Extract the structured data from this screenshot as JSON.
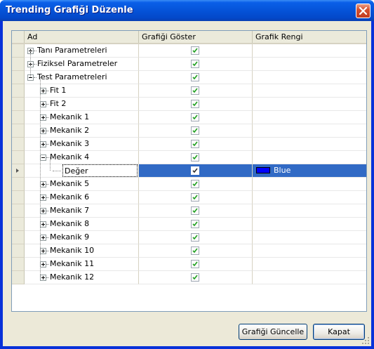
{
  "window": {
    "title": "Trending Grafiği Düzenle"
  },
  "grid": {
    "columns": [
      "Ad",
      "Grafiği Göster",
      "Grafik Rengi"
    ],
    "rows": [
      {
        "label": "Tanı Parametreleri",
        "level": 0,
        "state": "collapsed",
        "checked": true,
        "color": ""
      },
      {
        "label": "Fiziksel Parametreler",
        "level": 0,
        "state": "collapsed",
        "checked": true,
        "color": ""
      },
      {
        "label": "Test Parametreleri",
        "level": 0,
        "state": "expanded",
        "checked": true,
        "color": ""
      },
      {
        "label": "Fit 1",
        "level": 1,
        "state": "collapsed",
        "checked": true,
        "color": ""
      },
      {
        "label": "Fit 2",
        "level": 1,
        "state": "collapsed",
        "checked": true,
        "color": ""
      },
      {
        "label": "Mekanik 1",
        "level": 1,
        "state": "collapsed",
        "checked": true,
        "color": ""
      },
      {
        "label": "Mekanik 2",
        "level": 1,
        "state": "collapsed",
        "checked": true,
        "color": ""
      },
      {
        "label": "Mekanik 3",
        "level": 1,
        "state": "collapsed",
        "checked": true,
        "color": ""
      },
      {
        "label": "Mekanik 4",
        "level": 1,
        "state": "expanded",
        "checked": true,
        "color": ""
      },
      {
        "label": "Değer",
        "level": 2,
        "state": "leaf",
        "checked": true,
        "color": "Blue",
        "color_hex": "#0000ff",
        "selected": true
      },
      {
        "label": "Mekanik 5",
        "level": 1,
        "state": "collapsed",
        "checked": true,
        "color": ""
      },
      {
        "label": "Mekanik 6",
        "level": 1,
        "state": "collapsed",
        "checked": true,
        "color": ""
      },
      {
        "label": "Mekanik 7",
        "level": 1,
        "state": "collapsed",
        "checked": true,
        "color": ""
      },
      {
        "label": "Mekanik 8",
        "level": 1,
        "state": "collapsed",
        "checked": true,
        "color": ""
      },
      {
        "label": "Mekanik 9",
        "level": 1,
        "state": "collapsed",
        "checked": true,
        "color": ""
      },
      {
        "label": "Mekanik 10",
        "level": 1,
        "state": "collapsed",
        "checked": true,
        "color": ""
      },
      {
        "label": "Mekanik 11",
        "level": 1,
        "state": "collapsed",
        "checked": true,
        "color": ""
      },
      {
        "label": "Mekanik 12",
        "level": 1,
        "state": "collapsed",
        "checked": true,
        "color": ""
      }
    ]
  },
  "buttons": {
    "update": "Grafiği Güncelle",
    "close": "Kapat"
  },
  "colors": {
    "selection": "#316ac5",
    "titlebar": "#0553d8"
  }
}
